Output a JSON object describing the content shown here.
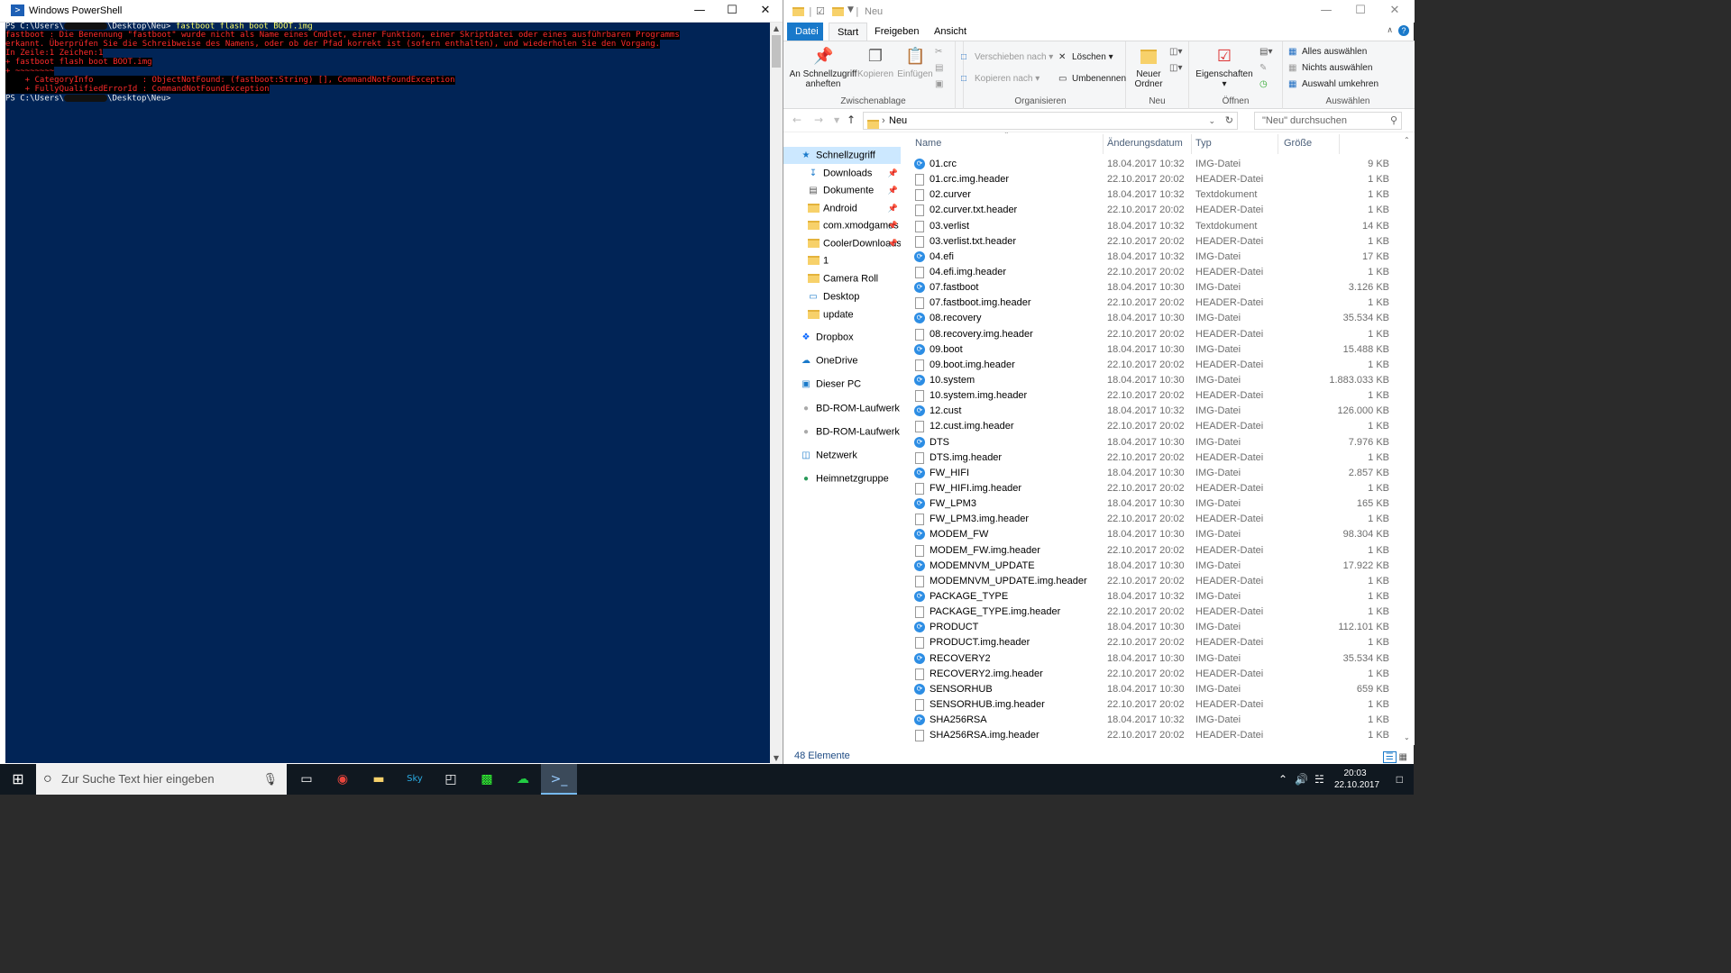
{
  "powershell": {
    "title": "Windows PowerShell",
    "lines": [
      {
        "text": "PS C:\\Users\\",
        "extra": "\\Desktop\\Neu> ",
        "cmd": "fastboot flash boot BOOT.img"
      },
      {
        "err": "fastboot : Die Benennung \"fastboot\" wurde nicht als Name eines Cmdlet, einer Funktion, einer Skriptdatei oder eines ausführbaren Programms"
      },
      {
        "err": "erkannt. Überprüfen Sie die Schreibweise des Namens, oder ob der Pfad korrekt ist (sofern enthalten), und wiederholen Sie den Vorgang."
      },
      {
        "err": "In Zeile:1 Zeichen:1"
      },
      {
        "err": "+ fastboot flash boot BOOT.img"
      },
      {
        "err": "+ ~~~~~~~~"
      },
      {
        "err": "    + CategoryInfo          : ObjectNotFound: (fastboot:String) [], CommandNotFoundException"
      },
      {
        "err": "    + FullyQualifiedErrorId : CommandNotFoundException"
      },
      {
        "text": ""
      },
      {
        "text": "PS C:\\Users\\",
        "extra": "\\Desktop\\Neu>"
      }
    ]
  },
  "explorer": {
    "title": "Neu",
    "tabs": [
      "Datei",
      "Start",
      "Freigeben",
      "Ansicht"
    ],
    "ribbon": {
      "pin": "An Schnellzugriff anheften",
      "copy": "Kopieren",
      "paste": "Einfügen",
      "group_clipboard": "Zwischenablage",
      "move_to": "Verschieben nach",
      "copy_to": "Kopieren nach",
      "delete": "Löschen",
      "rename": "Umbenennen",
      "group_organize": "Organisieren",
      "new_folder": "Neuer Ordner",
      "group_new": "Neu",
      "properties": "Eigenschaften",
      "group_open": "Öffnen",
      "select_all": "Alles auswählen",
      "select_none": "Nichts auswählen",
      "invert": "Auswahl umkehren",
      "group_select": "Auswählen"
    },
    "address": "Neu",
    "search_placeholder": "\"Neu\" durchsuchen",
    "nav": [
      {
        "label": "Schnellzugriff",
        "icon": "star-icon",
        "indent": 0,
        "sel": true
      },
      {
        "label": "Downloads",
        "icon": "download-icon",
        "indent": 1,
        "pin": true
      },
      {
        "label": "Dokumente",
        "icon": "documents-icon",
        "indent": 1,
        "pin": true
      },
      {
        "label": "Android",
        "icon": "folder-icon",
        "indent": 1,
        "pin": true
      },
      {
        "label": "com.xmodgames",
        "icon": "folder-icon",
        "indent": 1,
        "pin": true
      },
      {
        "label": "CoolerDownloads",
        "icon": "folder-icon",
        "indent": 1,
        "pin": true
      },
      {
        "label": "1",
        "icon": "folder-icon",
        "indent": 1
      },
      {
        "label": "Camera Roll",
        "icon": "folder-icon",
        "indent": 1
      },
      {
        "label": "Desktop",
        "icon": "desktop-icon",
        "indent": 1
      },
      {
        "label": "update",
        "icon": "folder-icon",
        "indent": 1
      },
      {
        "label": "Dropbox",
        "icon": "dropbox-icon",
        "indent": 0
      },
      {
        "label": "OneDrive",
        "icon": "cloud-icon",
        "indent": 0
      },
      {
        "label": "Dieser PC",
        "icon": "pc-icon",
        "indent": 0
      },
      {
        "label": "BD-ROM-Laufwerk (H",
        "icon": "disc-icon",
        "indent": 0
      },
      {
        "label": "BD-ROM-Laufwerk (I",
        "icon": "disc-icon",
        "indent": 0
      },
      {
        "label": "Netzwerk",
        "icon": "network-icon",
        "indent": 0
      },
      {
        "label": "Heimnetzgruppe",
        "icon": "homegroup-icon",
        "indent": 0
      }
    ],
    "columns": [
      "Name",
      "Änderungsdatum",
      "Typ",
      "Größe"
    ],
    "files": [
      [
        "01.crc",
        "18.04.2017 10:32",
        "IMG-Datei",
        "9 KB",
        "img"
      ],
      [
        "01.crc.img.header",
        "22.10.2017 20:02",
        "HEADER-Datei",
        "1 KB",
        "doc"
      ],
      [
        "02.curver",
        "18.04.2017 10:32",
        "Textdokument",
        "1 KB",
        "doc"
      ],
      [
        "02.curver.txt.header",
        "22.10.2017 20:02",
        "HEADER-Datei",
        "1 KB",
        "doc"
      ],
      [
        "03.verlist",
        "18.04.2017 10:32",
        "Textdokument",
        "14 KB",
        "doc"
      ],
      [
        "03.verlist.txt.header",
        "22.10.2017 20:02",
        "HEADER-Datei",
        "1 KB",
        "doc"
      ],
      [
        "04.efi",
        "18.04.2017 10:32",
        "IMG-Datei",
        "17 KB",
        "img"
      ],
      [
        "04.efi.img.header",
        "22.10.2017 20:02",
        "HEADER-Datei",
        "1 KB",
        "doc"
      ],
      [
        "07.fastboot",
        "18.04.2017 10:30",
        "IMG-Datei",
        "3.126 KB",
        "img"
      ],
      [
        "07.fastboot.img.header",
        "22.10.2017 20:02",
        "HEADER-Datei",
        "1 KB",
        "doc"
      ],
      [
        "08.recovery",
        "18.04.2017 10:30",
        "IMG-Datei",
        "35.534 KB",
        "img"
      ],
      [
        "08.recovery.img.header",
        "22.10.2017 20:02",
        "HEADER-Datei",
        "1 KB",
        "doc"
      ],
      [
        "09.boot",
        "18.04.2017 10:30",
        "IMG-Datei",
        "15.488 KB",
        "img"
      ],
      [
        "09.boot.img.header",
        "22.10.2017 20:02",
        "HEADER-Datei",
        "1 KB",
        "doc"
      ],
      [
        "10.system",
        "18.04.2017 10:30",
        "IMG-Datei",
        "1.883.033 KB",
        "img"
      ],
      [
        "10.system.img.header",
        "22.10.2017 20:02",
        "HEADER-Datei",
        "1 KB",
        "doc"
      ],
      [
        "12.cust",
        "18.04.2017 10:32",
        "IMG-Datei",
        "126.000 KB",
        "img"
      ],
      [
        "12.cust.img.header",
        "22.10.2017 20:02",
        "HEADER-Datei",
        "1 KB",
        "doc"
      ],
      [
        "DTS",
        "18.04.2017 10:30",
        "IMG-Datei",
        "7.976 KB",
        "img"
      ],
      [
        "DTS.img.header",
        "22.10.2017 20:02",
        "HEADER-Datei",
        "1 KB",
        "doc"
      ],
      [
        "FW_HIFI",
        "18.04.2017 10:30",
        "IMG-Datei",
        "2.857 KB",
        "img"
      ],
      [
        "FW_HIFI.img.header",
        "22.10.2017 20:02",
        "HEADER-Datei",
        "1 KB",
        "doc"
      ],
      [
        "FW_LPM3",
        "18.04.2017 10:30",
        "IMG-Datei",
        "165 KB",
        "img"
      ],
      [
        "FW_LPM3.img.header",
        "22.10.2017 20:02",
        "HEADER-Datei",
        "1 KB",
        "doc"
      ],
      [
        "MODEM_FW",
        "18.04.2017 10:30",
        "IMG-Datei",
        "98.304 KB",
        "img"
      ],
      [
        "MODEM_FW.img.header",
        "22.10.2017 20:02",
        "HEADER-Datei",
        "1 KB",
        "doc"
      ],
      [
        "MODEMNVM_UPDATE",
        "18.04.2017 10:30",
        "IMG-Datei",
        "17.922 KB",
        "img"
      ],
      [
        "MODEMNVM_UPDATE.img.header",
        "22.10.2017 20:02",
        "HEADER-Datei",
        "1 KB",
        "doc"
      ],
      [
        "PACKAGE_TYPE",
        "18.04.2017 10:32",
        "IMG-Datei",
        "1 KB",
        "img"
      ],
      [
        "PACKAGE_TYPE.img.header",
        "22.10.2017 20:02",
        "HEADER-Datei",
        "1 KB",
        "doc"
      ],
      [
        "PRODUCT",
        "18.04.2017 10:30",
        "IMG-Datei",
        "112.101 KB",
        "img"
      ],
      [
        "PRODUCT.img.header",
        "22.10.2017 20:02",
        "HEADER-Datei",
        "1 KB",
        "doc"
      ],
      [
        "RECOVERY2",
        "18.04.2017 10:30",
        "IMG-Datei",
        "35.534 KB",
        "img"
      ],
      [
        "RECOVERY2.img.header",
        "22.10.2017 20:02",
        "HEADER-Datei",
        "1 KB",
        "doc"
      ],
      [
        "SENSORHUB",
        "18.04.2017 10:30",
        "IMG-Datei",
        "659 KB",
        "img"
      ],
      [
        "SENSORHUB.img.header",
        "22.10.2017 20:02",
        "HEADER-Datei",
        "1 KB",
        "doc"
      ],
      [
        "SHA256RSA",
        "18.04.2017 10:32",
        "IMG-Datei",
        "1 KB",
        "img"
      ],
      [
        "SHA256RSA.img.header",
        "22.10.2017 20:02",
        "HEADER-Datei",
        "1 KB",
        "doc"
      ]
    ],
    "status": "48 Elemente"
  },
  "taskbar": {
    "search_placeholder": "Zur Suche Text hier eingeben",
    "time": "20:03",
    "date": "22.10.2017"
  },
  "colors": {
    "console_bg": "#012456",
    "error": "#ff2a2a",
    "accent": "#1979ca"
  }
}
